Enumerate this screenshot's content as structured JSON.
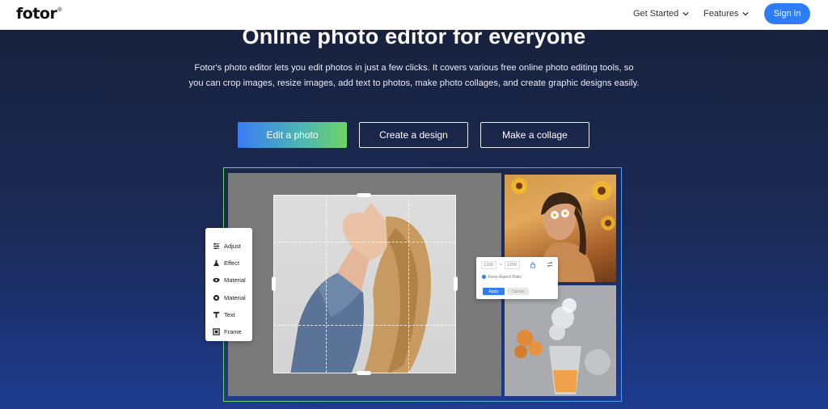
{
  "header": {
    "logo": "fotor",
    "logo_mark": "®",
    "nav": [
      {
        "label": "Get Started"
      },
      {
        "label": "Features"
      }
    ],
    "signin_label": "Sign in"
  },
  "hero": {
    "title": "Online photo editor for everyone",
    "description": "Fotor's photo editor lets you edit photos in just a few clicks. It covers various free online photo editing tools, so you can crop images, resize images, add text to photos, make photo collages, and create graphic designs easily.",
    "buttons": [
      {
        "label": "Edit a photo"
      },
      {
        "label": "Create a design"
      },
      {
        "label": "Make a collage"
      }
    ]
  },
  "demo": {
    "tools": [
      {
        "label": "Adjust",
        "icon": "sliders-icon"
      },
      {
        "label": "Effect",
        "icon": "flask-icon"
      },
      {
        "label": "Material",
        "icon": "eye-icon"
      },
      {
        "label": "Material",
        "icon": "circle-icon"
      },
      {
        "label": "Text",
        "icon": "text-icon"
      },
      {
        "label": "Frame",
        "icon": "frame-icon"
      }
    ],
    "resize": {
      "width": "1200",
      "times": "×",
      "height": "1200",
      "keep_ratio": "Keep Aspect Ratio",
      "apply": "Apply",
      "cancel": "Cancel"
    }
  },
  "colors": {
    "accent": "#2f7df6",
    "gradient_start": "#3a7cf4",
    "gradient_end": "#6fd364"
  }
}
